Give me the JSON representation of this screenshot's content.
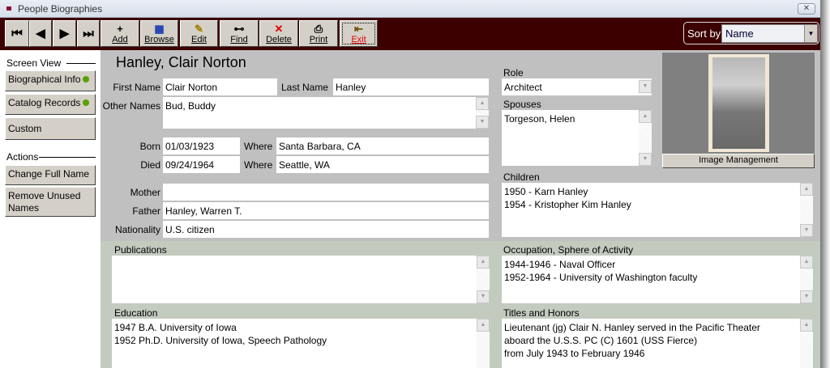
{
  "window": {
    "title": "People Biographies",
    "close_icon": "close-icon"
  },
  "toolbar": {
    "first": "⏮",
    "prev": "◀",
    "next": "▶",
    "last": "⏭",
    "add": "Add",
    "browse": "Browse",
    "edit": "Edit",
    "find": "Find",
    "delete": "Delete",
    "print": "Print",
    "exit": "Exit",
    "sort_label": "Sort by",
    "sort_value": "Name"
  },
  "sidebar": {
    "screen_view": "Screen View",
    "biographical": "Biographical Info",
    "catalog": "Catalog Records",
    "custom": "Custom",
    "actions": "Actions",
    "change_name": "Change Full Name",
    "remove_unused": "Remove Unused Names",
    "indicator_color": "#5aa000"
  },
  "record": {
    "full_name": "Hanley, Clair Norton",
    "first_name_label": "First Name",
    "first_name": "Clair Norton",
    "last_name_label": "Last Name",
    "last_name": "Hanley",
    "other_names_label": "Other Names",
    "other_names": "Bud, Buddy",
    "born_label": "Born",
    "born": "01/03/1923",
    "born_where_label": "Where",
    "born_where": "Santa Barbara, CA",
    "died_label": "Died",
    "died": "09/24/1964",
    "died_where_label": "Where",
    "died_where": "Seattle, WA",
    "mother_label": "Mother",
    "mother": "",
    "father_label": "Father",
    "father": "Hanley, Warren T.",
    "nationality_label": "Nationality",
    "nationality": "U.S. citizen",
    "role_label": "Role",
    "role": "Architect",
    "spouses_label": "Spouses",
    "spouses": "Torgeson, Helen",
    "children_label": "Children",
    "children": "1950 - Karn Hanley\n1954 - Kristopher Kim Hanley",
    "image_management": "Image Management",
    "publications_label": "Publications",
    "publications": "",
    "occupation_label": "Occupation, Sphere of Activity",
    "occupation": "1944-1946 - Naval Officer\n1952-1964 - University of Washington faculty",
    "education_label": "Education",
    "education": "1947 B.A. University of Iowa\n1952 Ph.D. University of Iowa, Speech Pathology",
    "titles_label": "Titles and Honors",
    "titles": "Lieutenant (jg) Clair N. Hanley served in the Pacific Theater\naboard the U.S.S. PC (C) 1601 (USS Fierce)\nfrom July 1943 to February 1946"
  }
}
